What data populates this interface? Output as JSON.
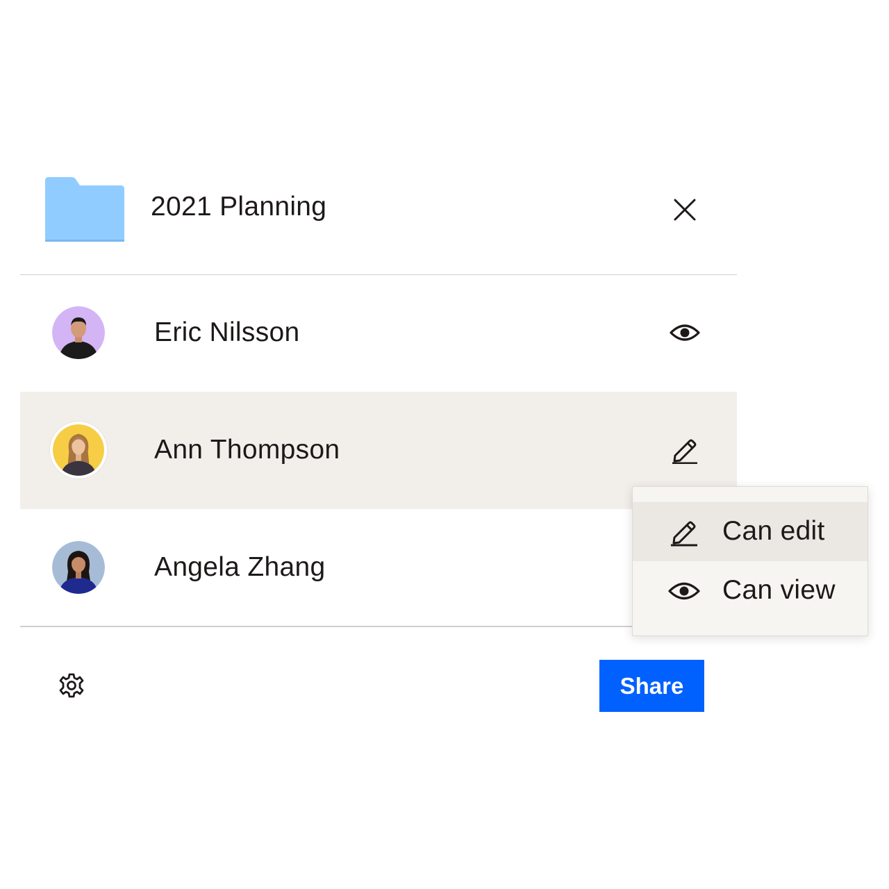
{
  "folder": {
    "title": "2021 Planning",
    "icon": "folder-icon",
    "color": "#90ccff"
  },
  "members": [
    {
      "name": "Eric Nilsson",
      "permission_icon": "eye-icon",
      "avatar_bg": "#d3b5f5"
    },
    {
      "name": "Ann Thompson",
      "permission_icon": "pencil-icon",
      "avatar_bg": "#f7cd45",
      "highlighted": true
    },
    {
      "name": "Angela Zhang",
      "permission_icon": "",
      "avatar_bg": "#a6bcd6"
    }
  ],
  "permission_menu": {
    "items": [
      {
        "label": "Can edit",
        "icon": "pencil-icon",
        "active": true
      },
      {
        "label": "Can view",
        "icon": "eye-icon",
        "active": false
      }
    ]
  },
  "footer": {
    "share_label": "Share",
    "settings_icon": "gear-icon",
    "accent": "#0061fe"
  },
  "colors": {
    "row_highlight": "#f2efeb",
    "text": "#1e1919",
    "divider": "#cfcfcf"
  }
}
